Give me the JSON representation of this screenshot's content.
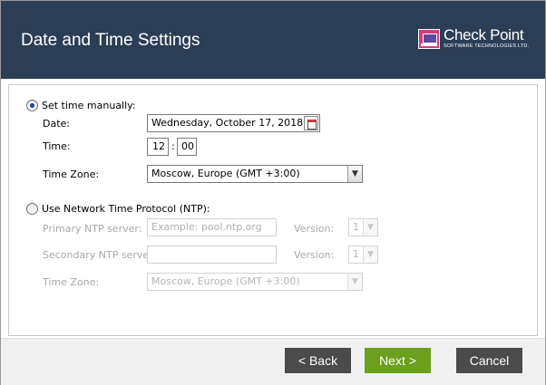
{
  "header": {
    "title": "Date and Time Settings",
    "logo": {
      "name": "Check Point",
      "subtitle": "SOFTWARE TECHNOLOGIES LTD."
    }
  },
  "manual": {
    "label": "Set time manually:",
    "selected": true,
    "date_label": "Date:",
    "date_value": "Wednesday, October 17, 2018",
    "time_label": "Time:",
    "hour": "12",
    "separator": ":",
    "minute": "00",
    "timezone_label": "Time Zone:",
    "timezone_value": "Moscow, Europe (GMT +3:00)"
  },
  "ntp": {
    "label": "Use Network Time Protocol (NTP):",
    "selected": false,
    "primary_label": "Primary NTP server:",
    "primary_placeholder": "Example: pool.ntp.org",
    "secondary_label": "Secondary NTP server:",
    "version_label": "Version:",
    "primary_version": "1",
    "secondary_version": "1",
    "timezone_label": "Time Zone:",
    "timezone_value": "Moscow, Europe (GMT +3:00)"
  },
  "footer": {
    "back_label": "< Back",
    "next_label": "Next >",
    "cancel_label": "Cancel"
  },
  "colors": {
    "header_bg": "#2c3e55",
    "next_button": "#6aa01c",
    "gray_button": "#4b4b4b",
    "logo_accent": "#d83a7c"
  }
}
